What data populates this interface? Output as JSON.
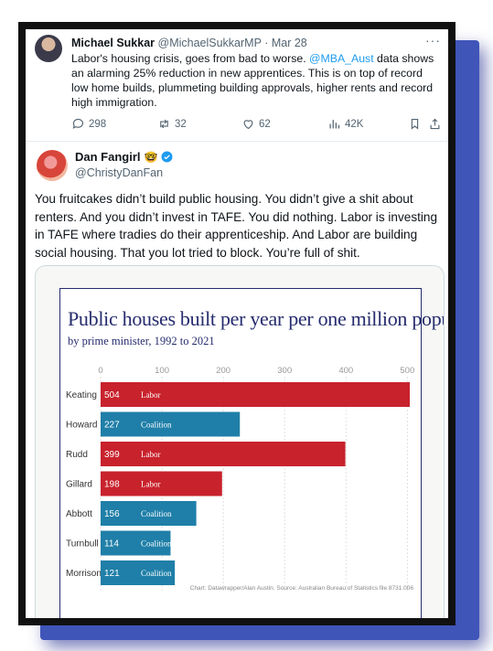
{
  "tweet1": {
    "name": "Michael Sukkar",
    "handle": "@MichaelSukkarMP",
    "date": "· Mar 28",
    "more": "···",
    "text_part1": "Labor's housing crisis, goes from bad to worse. ",
    "mention": "@MBA_Aust",
    "text_part2": " data shows an alarming 25% reduction in new apprentices. This is on top of record low home builds, plummeting building approvals, higher rents and record high immigration.",
    "stats": {
      "replies": "298",
      "reposts": "32",
      "likes": "62",
      "views": "42K"
    }
  },
  "tweet2": {
    "name": "Dan Fangirl",
    "emoji": "🤓",
    "handle": "@ChristyDanFan",
    "text": "You fruitcakes didn’t build public housing. You didn’t give a shit about renters. And you didn’t invest in TAFE. You did nothing. Labor is investing in TAFE where tradies do their apprenticeship. And Labor are building social housing. That you lot tried to block. You’re full of shit."
  },
  "colors": {
    "labor": "#c8222d",
    "coalition": "#1f7fa8",
    "accent": "#1d9bf0",
    "title": "#262c6e"
  },
  "icons": [
    "reply-icon",
    "repost-icon",
    "like-icon",
    "views-icon",
    "bookmark-icon",
    "share-icon",
    "verified-icon"
  ],
  "chart_data": {
    "type": "bar",
    "orientation": "horizontal",
    "title": "Public houses built per year per one million population",
    "subtitle": "by prime minister, 1992 to 2021",
    "categories": [
      "Keating",
      "Howard",
      "Rudd",
      "Gillard",
      "Abbott",
      "Turnbull",
      "Morrison"
    ],
    "values": [
      504,
      227,
      399,
      198,
      156,
      114,
      121
    ],
    "parties": [
      "Labor",
      "Coalition",
      "Labor",
      "Labor",
      "Coalition",
      "Coalition",
      "Coalition"
    ],
    "xticks": [
      0,
      100,
      200,
      300,
      400,
      500
    ],
    "xlim": [
      0,
      504
    ],
    "grid": true,
    "source": "Chart: Datawrapper/Alan Austin. Source: Australian Bureau of Statistics file 8731.006"
  }
}
